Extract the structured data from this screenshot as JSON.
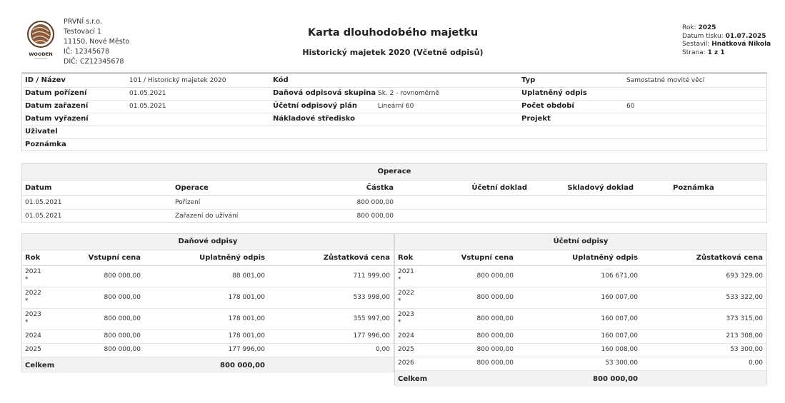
{
  "company": {
    "lines": [
      "PRVNÍ s.r.o.",
      "Testovací 1",
      "11150, Nové Město",
      "IČ: 12345678",
      "DIČ: CZ12345678"
    ],
    "logo_text": "WOODEN"
  },
  "header": {
    "title": "Karta dlouhodobého majetku",
    "subtitle": "Historický majetek 2020 (Včetně odpisů)"
  },
  "meta": {
    "rok_label": "Rok:",
    "rok": "2025",
    "tisk_label": "Datum tisku:",
    "tisk": "01.07.2025",
    "sestavil_label": "Sestavil:",
    "sestavil": "Hnátková Nikola",
    "strana_label": "Strana:",
    "strana": "1 z 1"
  },
  "info": {
    "rows": [
      {
        "l1": "ID / Název",
        "v1": "101 / Historický majetek 2020",
        "l2": "Kód",
        "v2": "",
        "l3": "Typ",
        "v3": "Samostatné movité věci"
      },
      {
        "l1": "Datum pořízení",
        "v1": "01.05.2021",
        "l2": "Daňová odpisová skupina",
        "v2": "Sk. 2 - rovnoměrně",
        "l3": "Uplatněný odpis",
        "v3": ""
      },
      {
        "l1": "Datum zařazení",
        "v1": "01.05.2021",
        "l2": "Účetní odpisový plán",
        "v2": "Lineární 60",
        "l3": "Počet období",
        "v3": "60"
      },
      {
        "l1": "Datum vyřazení",
        "v1": "",
        "l2": "Nákladové středisko",
        "v2": "",
        "l3": "Projekt",
        "v3": ""
      },
      {
        "l1": "Uživatel",
        "v1": "",
        "l2": "",
        "v2": "",
        "l3": "",
        "v3": ""
      },
      {
        "l1": "Poznámka",
        "v1": "",
        "l2": "",
        "v2": "",
        "l3": "",
        "v3": ""
      }
    ]
  },
  "operace": {
    "title": "Operace",
    "columns": [
      "Datum",
      "Operace",
      "Částka",
      "Účetní doklad",
      "Skladový doklad",
      "Poznámka"
    ],
    "rows": [
      {
        "datum": "01.05.2021",
        "operace": "Pořízení",
        "castka": "800 000,00"
      },
      {
        "datum": "01.05.2021",
        "operace": "Zařazení do užívání",
        "castka": "800 000,00"
      }
    ]
  },
  "danove": {
    "title": "Daňové odpisy",
    "columns": [
      "Rok",
      "Vstupní cena",
      "Uplatněný odpis",
      "Zůstatková cena"
    ],
    "rows": [
      {
        "rok": "2021",
        "mark": "*",
        "vstup": "800 000,00",
        "odpis": "88 001,00",
        "zustatek": "711 999,00"
      },
      {
        "rok": "2022",
        "mark": "*",
        "vstup": "800 000,00",
        "odpis": "178 001,00",
        "zustatek": "533 998,00"
      },
      {
        "rok": "2023",
        "mark": "*",
        "vstup": "800 000,00",
        "odpis": "178 001,00",
        "zustatek": "355 997,00"
      },
      {
        "rok": "2024",
        "mark": "",
        "vstup": "800 000,00",
        "odpis": "178 001,00",
        "zustatek": "177 996,00"
      },
      {
        "rok": "2025",
        "mark": "",
        "vstup": "800 000,00",
        "odpis": "177 996,00",
        "zustatek": "0,00"
      }
    ],
    "total_label": "Celkem",
    "total": "800 000,00"
  },
  "ucetni": {
    "title": "Účetní odpisy",
    "columns": [
      "Rok",
      "Vstupní cena",
      "Uplatněný odpis",
      "Zůstatková cena"
    ],
    "rows": [
      {
        "rok": "2021",
        "mark": "*",
        "vstup": "800 000,00",
        "odpis": "106 671,00",
        "zustatek": "693 329,00"
      },
      {
        "rok": "2022",
        "mark": "*",
        "vstup": "800 000,00",
        "odpis": "160 007,00",
        "zustatek": "533 322,00"
      },
      {
        "rok": "2023",
        "mark": "*",
        "vstup": "800 000,00",
        "odpis": "160 007,00",
        "zustatek": "373 315,00"
      },
      {
        "rok": "2024",
        "mark": "",
        "vstup": "800 000,00",
        "odpis": "160 007,00",
        "zustatek": "213 308,00"
      },
      {
        "rok": "2025",
        "mark": "",
        "vstup": "800 000,00",
        "odpis": "160 008,00",
        "zustatek": "53 300,00"
      },
      {
        "rok": "2026",
        "mark": "",
        "vstup": "800 000,00",
        "odpis": "53 300,00",
        "zustatek": "0,00"
      }
    ],
    "total_label": "Celkem",
    "total": "800 000,00"
  }
}
